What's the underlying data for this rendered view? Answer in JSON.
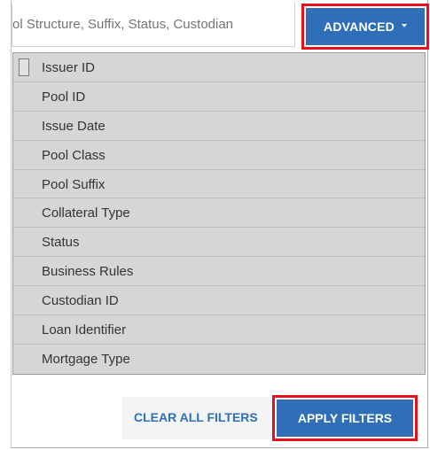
{
  "search": {
    "visible_text": "ol Structure, Suffix, Status, Custodian"
  },
  "advanced_button": {
    "label": "ADVANCED",
    "icon": "caret-down-icon"
  },
  "filter_options": [
    {
      "label": "Issuer ID",
      "has_checkbox": true
    },
    {
      "label": "Pool ID"
    },
    {
      "label": "Issue Date"
    },
    {
      "label": "Pool Class"
    },
    {
      "label": "Pool Suffix"
    },
    {
      "label": "Collateral Type"
    },
    {
      "label": "Status"
    },
    {
      "label": "Business Rules"
    },
    {
      "label": "Custodian ID"
    },
    {
      "label": "Loan Identifier"
    },
    {
      "label": "Mortgage Type"
    }
  ],
  "footer": {
    "clear_label": "CLEAR ALL FILTERS",
    "apply_label": "APPLY FILTERS"
  },
  "colors": {
    "button_blue": "#2f6fb7",
    "highlight_red": "#e5101b",
    "dropdown_gray": "#d5d6d7"
  }
}
